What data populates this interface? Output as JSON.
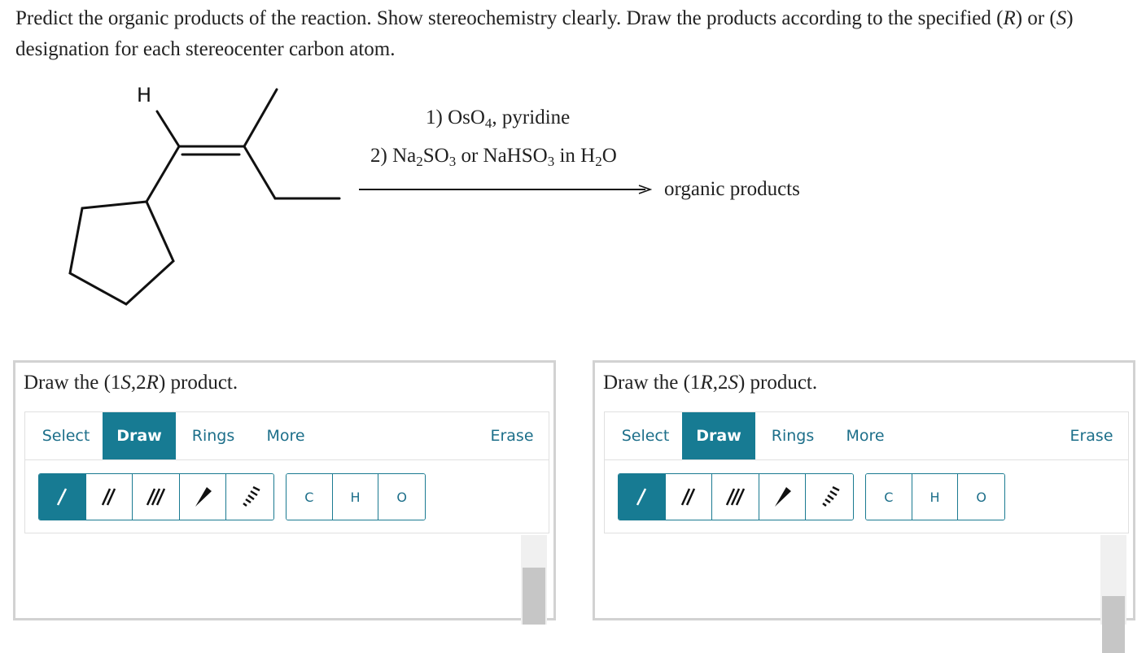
{
  "question": {
    "prompt_part1": "Predict the organic products of the reaction. Show stereochemistry clearly. Draw the products according to the specified (",
    "prompt_R": "R",
    "prompt_part2": ") or (",
    "prompt_S": "S",
    "prompt_part3": ") designation for each stereocenter carbon atom."
  },
  "reaction": {
    "reactant_atom_label": "H",
    "step1_prefix": "1) OsO",
    "step1_sub": "4",
    "step1_suffix": ", pyridine",
    "step2_prefix": "2) Na",
    "step2_sub1": "2",
    "step2_mid1": "SO",
    "step2_sub2": "3",
    "step2_mid2": " or NaHSO",
    "step2_sub3": "3",
    "step2_mid3": " in H",
    "step2_sub4": "2",
    "step2_suffix": "O",
    "product_label": "organic products"
  },
  "panels": [
    {
      "title_prefix": "Draw the (1",
      "title_c1": "S",
      "title_mid": ",2",
      "title_c2": "R",
      "title_suffix": ") product.",
      "tabs": [
        "Select",
        "Draw",
        "Rings",
        "More"
      ],
      "active_tab": "Draw",
      "erase_label": "Erase",
      "bond_tools": [
        "single-bond",
        "double-bond",
        "triple-bond",
        "wedge-bond",
        "hash-bond"
      ],
      "active_tool": "single-bond",
      "atoms": [
        "C",
        "H",
        "O"
      ]
    },
    {
      "title_prefix": "Draw the (1",
      "title_c1": "R",
      "title_mid": ",2",
      "title_c2": "S",
      "title_suffix": ") product.",
      "tabs": [
        "Select",
        "Draw",
        "Rings",
        "More"
      ],
      "active_tab": "Draw",
      "erase_label": "Erase",
      "bond_tools": [
        "single-bond",
        "double-bond",
        "triple-bond",
        "wedge-bond",
        "hash-bond"
      ],
      "active_tool": "single-bond",
      "atoms": [
        "C",
        "H",
        "O"
      ]
    }
  ],
  "colors": {
    "accent": "#177b93",
    "tab_text": "#1d6f8a",
    "panel_border": "#d2d2d2"
  }
}
